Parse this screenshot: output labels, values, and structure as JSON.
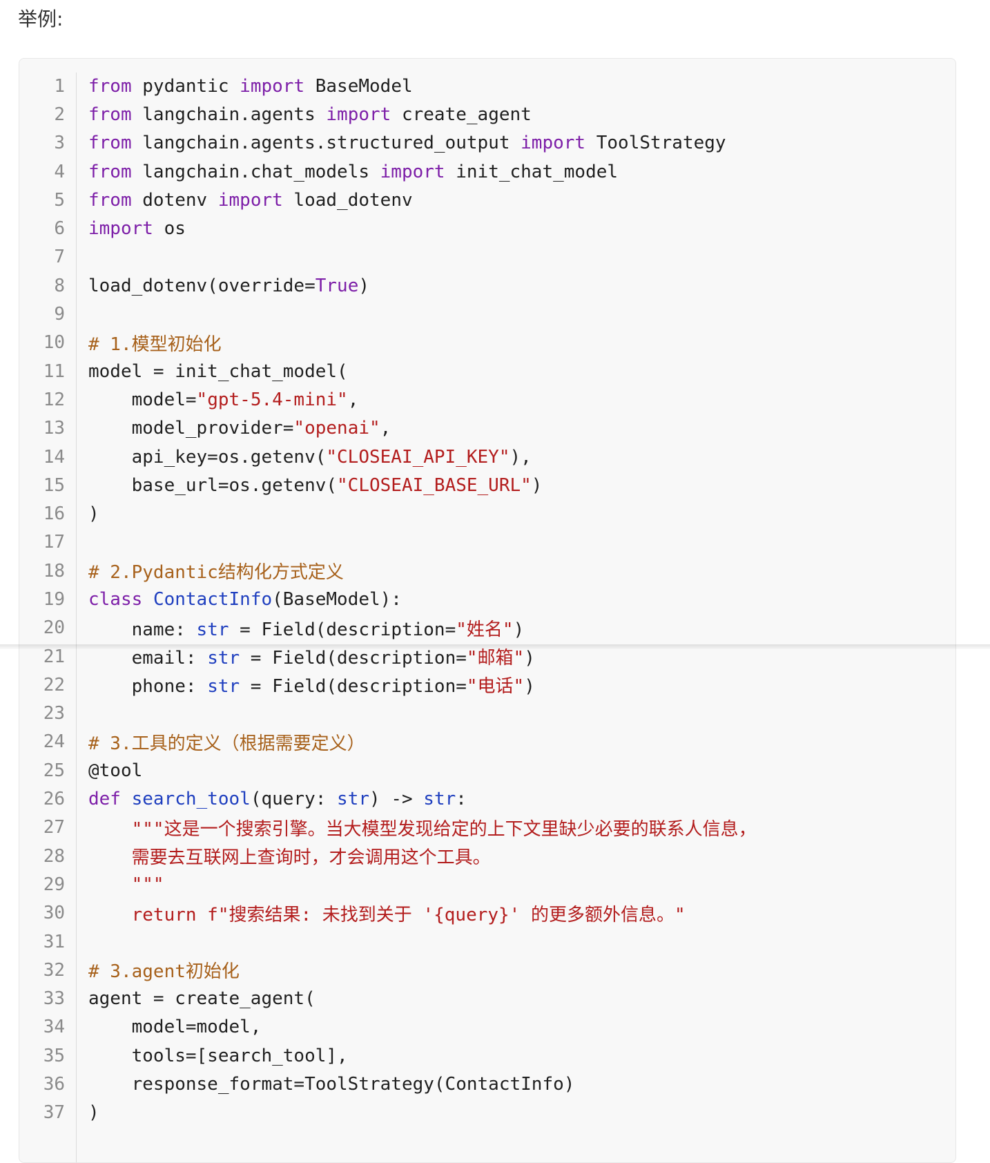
{
  "intro": {
    "text": "举例:"
  },
  "code": {
    "lines": [
      {
        "n": "1",
        "tokens": [
          {
            "t": "from",
            "c": "kw"
          },
          {
            "t": " pydantic ",
            "c": "default"
          },
          {
            "t": "import",
            "c": "kw"
          },
          {
            "t": " BaseModel",
            "c": "default"
          }
        ]
      },
      {
        "n": "2",
        "tokens": [
          {
            "t": "from",
            "c": "kw"
          },
          {
            "t": " langchain.agents ",
            "c": "default"
          },
          {
            "t": "import",
            "c": "kw"
          },
          {
            "t": " create_agent",
            "c": "default"
          }
        ]
      },
      {
        "n": "3",
        "tokens": [
          {
            "t": "from",
            "c": "kw"
          },
          {
            "t": " langchain.agents.structured_output ",
            "c": "default"
          },
          {
            "t": "import",
            "c": "kw"
          },
          {
            "t": " ToolStrategy",
            "c": "default"
          }
        ]
      },
      {
        "n": "4",
        "tokens": [
          {
            "t": "from",
            "c": "kw"
          },
          {
            "t": " langchain.chat_models ",
            "c": "default"
          },
          {
            "t": "import",
            "c": "kw"
          },
          {
            "t": " init_chat_model",
            "c": "default"
          }
        ]
      },
      {
        "n": "5",
        "tokens": [
          {
            "t": "from",
            "c": "kw"
          },
          {
            "t": " dotenv ",
            "c": "default"
          },
          {
            "t": "import",
            "c": "kw"
          },
          {
            "t": " load_dotenv",
            "c": "default"
          }
        ]
      },
      {
        "n": "6",
        "tokens": [
          {
            "t": "import",
            "c": "kw"
          },
          {
            "t": " os",
            "c": "default"
          }
        ]
      },
      {
        "n": "7",
        "tokens": []
      },
      {
        "n": "8",
        "tokens": [
          {
            "t": "load_dotenv(override=",
            "c": "default"
          },
          {
            "t": "True",
            "c": "kw"
          },
          {
            "t": ")",
            "c": "default"
          }
        ]
      },
      {
        "n": "9",
        "tokens": []
      },
      {
        "n": "10",
        "tokens": [
          {
            "t": "# 1.模型初始化",
            "c": "cmt"
          }
        ]
      },
      {
        "n": "11",
        "tokens": [
          {
            "t": "model = init_chat_model(",
            "c": "default"
          }
        ]
      },
      {
        "n": "12",
        "tokens": [
          {
            "t": "    model=",
            "c": "default"
          },
          {
            "t": "\"gpt-5.4-mini\"",
            "c": "str"
          },
          {
            "t": ",",
            "c": "default"
          }
        ]
      },
      {
        "n": "13",
        "tokens": [
          {
            "t": "    model_provider=",
            "c": "default"
          },
          {
            "t": "\"openai\"",
            "c": "str"
          },
          {
            "t": ",",
            "c": "default"
          }
        ]
      },
      {
        "n": "14",
        "tokens": [
          {
            "t": "    api_key=os.getenv(",
            "c": "default"
          },
          {
            "t": "\"CLOSEAI_API_KEY\"",
            "c": "str"
          },
          {
            "t": "),",
            "c": "default"
          }
        ]
      },
      {
        "n": "15",
        "tokens": [
          {
            "t": "    base_url=os.getenv(",
            "c": "default"
          },
          {
            "t": "\"CLOSEAI_BASE_URL\"",
            "c": "str"
          },
          {
            "t": ")",
            "c": "default"
          }
        ]
      },
      {
        "n": "16",
        "tokens": [
          {
            "t": ")",
            "c": "default"
          }
        ]
      },
      {
        "n": "17",
        "tokens": []
      },
      {
        "n": "18",
        "tokens": [
          {
            "t": "# 2.Pydantic结构化方式定义",
            "c": "cmt"
          }
        ]
      },
      {
        "n": "19",
        "tokens": [
          {
            "t": "class",
            "c": "kw"
          },
          {
            "t": " ",
            "c": "default"
          },
          {
            "t": "ContactInfo",
            "c": "fn"
          },
          {
            "t": "(BaseModel):",
            "c": "default"
          }
        ]
      },
      {
        "n": "20",
        "tokens": [
          {
            "t": "    name: ",
            "c": "default"
          },
          {
            "t": "str",
            "c": "bi"
          },
          {
            "t": " = Field(description=",
            "c": "default"
          },
          {
            "t": "\"姓名\"",
            "c": "str"
          },
          {
            "t": ")",
            "c": "default"
          }
        ]
      },
      {
        "n": "21",
        "tokens": [
          {
            "t": "    email: ",
            "c": "default"
          },
          {
            "t": "str",
            "c": "bi"
          },
          {
            "t": " = Field(description=",
            "c": "default"
          },
          {
            "t": "\"邮箱\"",
            "c": "str"
          },
          {
            "t": ")",
            "c": "default"
          }
        ]
      },
      {
        "n": "22",
        "tokens": [
          {
            "t": "    phone: ",
            "c": "default"
          },
          {
            "t": "str",
            "c": "bi"
          },
          {
            "t": " = Field(description=",
            "c": "default"
          },
          {
            "t": "\"电话\"",
            "c": "str"
          },
          {
            "t": ")",
            "c": "default"
          }
        ]
      },
      {
        "n": "23",
        "tokens": []
      },
      {
        "n": "24",
        "tokens": [
          {
            "t": "# 3.工具的定义（根据需要定义）",
            "c": "cmt"
          }
        ]
      },
      {
        "n": "25",
        "tokens": [
          {
            "t": "@tool",
            "c": "default"
          }
        ]
      },
      {
        "n": "26",
        "tokens": [
          {
            "t": "def",
            "c": "kw"
          },
          {
            "t": " ",
            "c": "default"
          },
          {
            "t": "search_tool",
            "c": "fn"
          },
          {
            "t": "(query: ",
            "c": "default"
          },
          {
            "t": "str",
            "c": "bi"
          },
          {
            "t": ") -> ",
            "c": "default"
          },
          {
            "t": "str",
            "c": "bi"
          },
          {
            "t": ":",
            "c": "default"
          }
        ]
      },
      {
        "n": "27",
        "tokens": [
          {
            "t": "    \"\"\"这是一个搜索引擎。当大模型发现给定的上下文里缺少必要的联系人信息，",
            "c": "str"
          }
        ]
      },
      {
        "n": "28",
        "tokens": [
          {
            "t": "    需要去互联网上查询时，才会调用这个工具。",
            "c": "str"
          }
        ]
      },
      {
        "n": "29",
        "tokens": [
          {
            "t": "    \"\"\"",
            "c": "str"
          }
        ]
      },
      {
        "n": "30",
        "tokens": [
          {
            "t": "    return f\"搜索结果: 未找到关于 '{query}' 的更多额外信息。\"",
            "c": "str"
          }
        ]
      },
      {
        "n": "31",
        "tokens": []
      },
      {
        "n": "32",
        "tokens": [
          {
            "t": "# 3.agent初始化",
            "c": "cmt"
          }
        ]
      },
      {
        "n": "33",
        "tokens": [
          {
            "t": "agent = create_agent(",
            "c": "default"
          }
        ]
      },
      {
        "n": "34",
        "tokens": [
          {
            "t": "    model=model,",
            "c": "default"
          }
        ]
      },
      {
        "n": "35",
        "tokens": [
          {
            "t": "    tools=[search_tool],",
            "c": "default"
          }
        ]
      },
      {
        "n": "36",
        "tokens": [
          {
            "t": "    response_format=ToolStrategy(ContactInfo)",
            "c": "default"
          }
        ]
      },
      {
        "n": "37",
        "tokens": [
          {
            "t": ")",
            "c": "default"
          }
        ]
      }
    ]
  }
}
